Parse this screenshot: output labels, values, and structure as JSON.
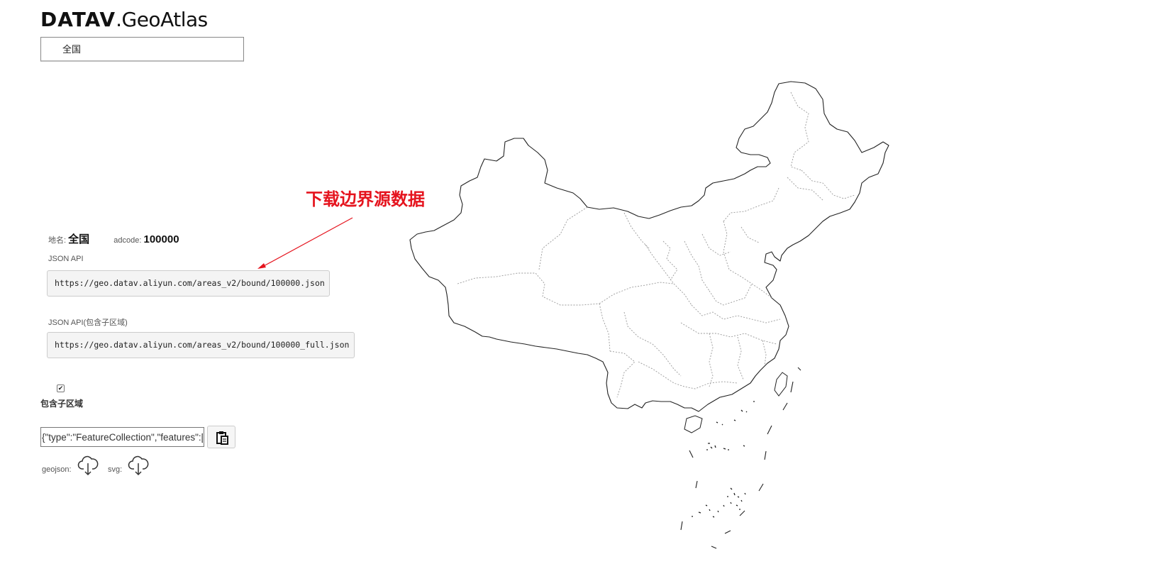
{
  "header": {
    "logo_bold": "DATAV",
    "logo_regular": ".GeoAtlas"
  },
  "region_select": {
    "value": "全国"
  },
  "annotation": {
    "text": "下载边界源数据",
    "color": "#e5141e"
  },
  "info": {
    "name_label": "地名:",
    "name_value": "全国",
    "adcode_label": "adcode:",
    "adcode_value": "100000"
  },
  "api": {
    "label": "JSON API",
    "url": "https://geo.datav.aliyun.com/areas_v2/bound/100000.json",
    "full_label": "JSON API(包含子区域)",
    "full_url": "https://geo.datav.aliyun.com/areas_v2/bound/100000_full.json"
  },
  "include_subregions": {
    "checked": true,
    "label": "包含子区域"
  },
  "json_output": {
    "value": "{\"type\":\"FeatureCollection\",\"features\":[{"
  },
  "copy_button": {
    "icon": "clipboard-icon"
  },
  "downloads": {
    "geojson_label": "geojson:",
    "svg_label": "svg:",
    "icon": "cloud-download-icon"
  },
  "map": {
    "region": "全国",
    "border_color": "#222222",
    "province_border_color": "#999999"
  }
}
